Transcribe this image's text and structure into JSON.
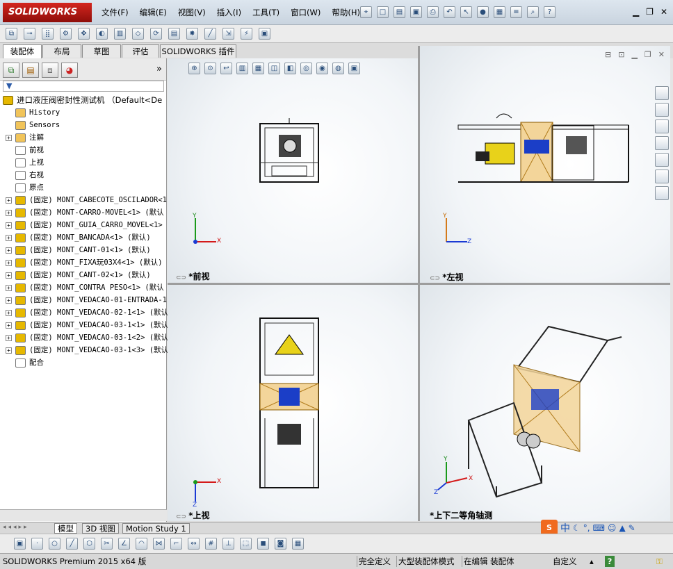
{
  "app": {
    "brand": "SOLIDWORKS"
  },
  "menu": [
    "文件(F)",
    "编辑(E)",
    "视图(V)",
    "插入(I)",
    "工具(T)",
    "窗口(W)",
    "帮助(H)"
  ],
  "window_buttons": [
    "minimize-icon",
    "restore-icon",
    "close-icon"
  ],
  "command_tabs": [
    "装配体",
    "布局",
    "草图",
    "评估",
    "SOLIDWORKS 插件"
  ],
  "tree": {
    "root": "进口液压阀密封性测试机 （Default<De",
    "items": [
      {
        "label": "History",
        "icon": "history-icon"
      },
      {
        "label": "Sensors",
        "icon": "sensors-icon"
      },
      {
        "label": "注解",
        "icon": "annotation-icon",
        "expand": true
      },
      {
        "label": "前视",
        "icon": "plane-icon"
      },
      {
        "label": "上视",
        "icon": "plane-icon"
      },
      {
        "label": "右视",
        "icon": "plane-icon"
      },
      {
        "label": "原点",
        "icon": "origin-icon"
      },
      {
        "label": "(固定) MONT_CABECOTE_OSCILADOR<1",
        "icon": "assembly-icon",
        "expand": true
      },
      {
        "label": "(固定) MONT-CARRO-MOVEL<1> (默认",
        "icon": "assembly-icon",
        "expand": true
      },
      {
        "label": "(固定) MONT_GUIA_CARRO_MOVEL<1>",
        "icon": "assembly-icon",
        "expand": true
      },
      {
        "label": "(固定) MONT_BANCADA<1> (默认)",
        "icon": "assembly-icon",
        "expand": true
      },
      {
        "label": "(固定) MONT_CANT-01<1> (默认)",
        "icon": "assembly-icon",
        "expand": true
      },
      {
        "label": "(固定) MONT_FIXA玩03X4<1> (默认)",
        "icon": "assembly-icon",
        "expand": true
      },
      {
        "label": "(固定) MONT_CANT-02<1> (默认)",
        "icon": "assembly-icon",
        "expand": true
      },
      {
        "label": "(固定) MONT_CONTRA PESO<1> (默认",
        "icon": "assembly-icon",
        "expand": true
      },
      {
        "label": "(固定) MONT_VEDACAO-01-ENTRADA-1",
        "icon": "assembly-icon",
        "expand": true
      },
      {
        "label": "(固定) MONT_VEDACAO-02-1<1> (默认",
        "icon": "assembly-icon",
        "expand": true
      },
      {
        "label": "(固定) MONT_VEDACAO-03-1<1> (默认",
        "icon": "assembly-icon",
        "expand": true
      },
      {
        "label": "(固定) MONT_VEDACAO-03-1<2> (默认",
        "icon": "assembly-icon",
        "expand": true
      },
      {
        "label": "(固定) MONT_VEDACAO-03-1<3> (默认",
        "icon": "assembly-icon",
        "expand": true
      },
      {
        "label": "配合",
        "icon": "mates-icon"
      }
    ]
  },
  "viewports": {
    "front": {
      "label": "*前视",
      "axes": [
        "Y",
        "X"
      ]
    },
    "left": {
      "label": "*左视",
      "axes": [
        "Y",
        "Z"
      ]
    },
    "top": {
      "label": "*上视",
      "axes": [
        "X",
        "Z"
      ]
    },
    "iso": {
      "label": "*上下二等角轴测",
      "axes": [
        "Y",
        "X",
        "Z"
      ]
    }
  },
  "bottom_tabs": [
    "模型",
    "3D 视图",
    "Motion Study 1"
  ],
  "status": {
    "product": "SOLIDWORKS Premium 2015 x64 版",
    "definition": "完全定义",
    "mode": "大型装配体模式",
    "editing": "在编辑 装配体",
    "units": "自定义",
    "help": "?"
  },
  "ime": {
    "chinese": "中"
  }
}
